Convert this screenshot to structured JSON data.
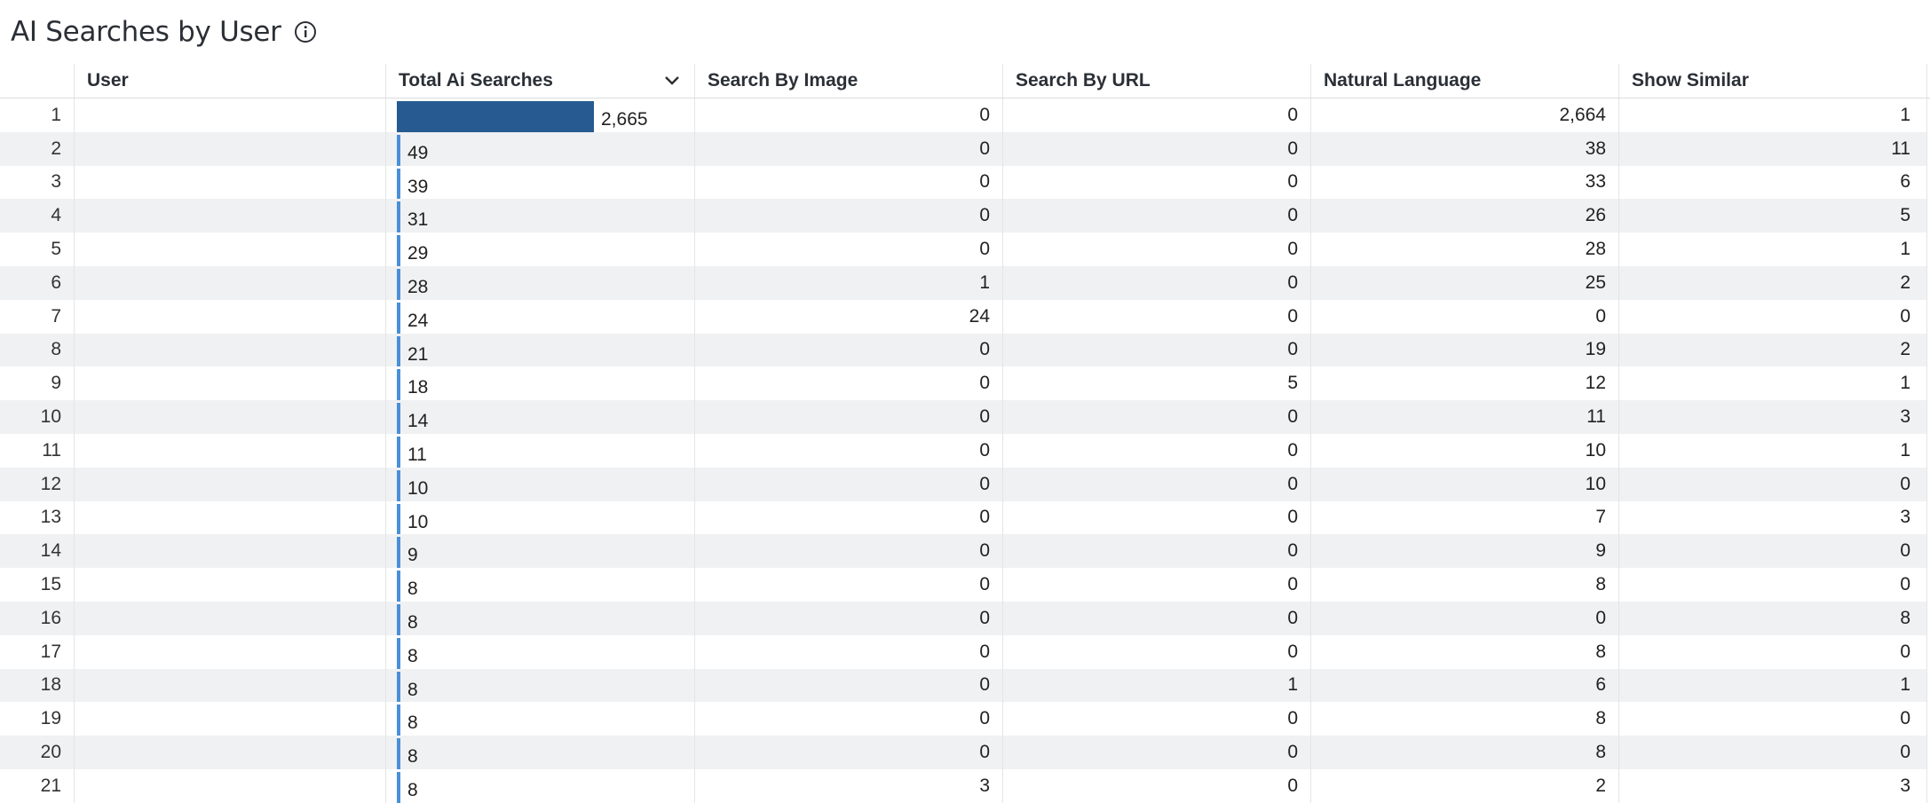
{
  "title": "AI Searches by User",
  "icons": {
    "info": "info-icon",
    "sort": "chevron-down-icon"
  },
  "colors": {
    "bar_max": "#265a91",
    "bar": "#4a90d9"
  },
  "columns": {
    "user": "User",
    "total": "Total Ai Searches",
    "image": "Search By Image",
    "url": "Search By URL",
    "natural": "Natural Language",
    "similar": "Show Similar"
  },
  "rows": [
    {
      "idx": "1",
      "total": 2665,
      "total_label": "2,665",
      "image": "0",
      "url": "0",
      "natural": "2,664",
      "similar": "1"
    },
    {
      "idx": "2",
      "total": 49,
      "total_label": "49",
      "image": "0",
      "url": "0",
      "natural": "38",
      "similar": "11"
    },
    {
      "idx": "3",
      "total": 39,
      "total_label": "39",
      "image": "0",
      "url": "0",
      "natural": "33",
      "similar": "6"
    },
    {
      "idx": "4",
      "total": 31,
      "total_label": "31",
      "image": "0",
      "url": "0",
      "natural": "26",
      "similar": "5"
    },
    {
      "idx": "5",
      "total": 29,
      "total_label": "29",
      "image": "0",
      "url": "0",
      "natural": "28",
      "similar": "1"
    },
    {
      "idx": "6",
      "total": 28,
      "total_label": "28",
      "image": "1",
      "url": "0",
      "natural": "25",
      "similar": "2"
    },
    {
      "idx": "7",
      "total": 24,
      "total_label": "24",
      "image": "24",
      "url": "0",
      "natural": "0",
      "similar": "0"
    },
    {
      "idx": "8",
      "total": 21,
      "total_label": "21",
      "image": "0",
      "url": "0",
      "natural": "19",
      "similar": "2"
    },
    {
      "idx": "9",
      "total": 18,
      "total_label": "18",
      "image": "0",
      "url": "5",
      "natural": "12",
      "similar": "1"
    },
    {
      "idx": "10",
      "total": 14,
      "total_label": "14",
      "image": "0",
      "url": "0",
      "natural": "11",
      "similar": "3"
    },
    {
      "idx": "11",
      "total": 11,
      "total_label": "11",
      "image": "0",
      "url": "0",
      "natural": "10",
      "similar": "1"
    },
    {
      "idx": "12",
      "total": 10,
      "total_label": "10",
      "image": "0",
      "url": "0",
      "natural": "10",
      "similar": "0"
    },
    {
      "idx": "13",
      "total": 10,
      "total_label": "10",
      "image": "0",
      "url": "0",
      "natural": "7",
      "similar": "3"
    },
    {
      "idx": "14",
      "total": 9,
      "total_label": "9",
      "image": "0",
      "url": "0",
      "natural": "9",
      "similar": "0"
    },
    {
      "idx": "15",
      "total": 8,
      "total_label": "8",
      "image": "0",
      "url": "0",
      "natural": "8",
      "similar": "0"
    },
    {
      "idx": "16",
      "total": 8,
      "total_label": "8",
      "image": "0",
      "url": "0",
      "natural": "0",
      "similar": "8"
    },
    {
      "idx": "17",
      "total": 8,
      "total_label": "8",
      "image": "0",
      "url": "0",
      "natural": "8",
      "similar": "0"
    },
    {
      "idx": "18",
      "total": 8,
      "total_label": "8",
      "image": "0",
      "url": "1",
      "natural": "6",
      "similar": "1"
    },
    {
      "idx": "19",
      "total": 8,
      "total_label": "8",
      "image": "0",
      "url": "0",
      "natural": "8",
      "similar": "0"
    },
    {
      "idx": "20",
      "total": 8,
      "total_label": "8",
      "image": "0",
      "url": "0",
      "natural": "8",
      "similar": "0"
    },
    {
      "idx": "21",
      "total": 8,
      "total_label": "8",
      "image": "3",
      "url": "0",
      "natural": "2",
      "similar": "3"
    }
  ]
}
